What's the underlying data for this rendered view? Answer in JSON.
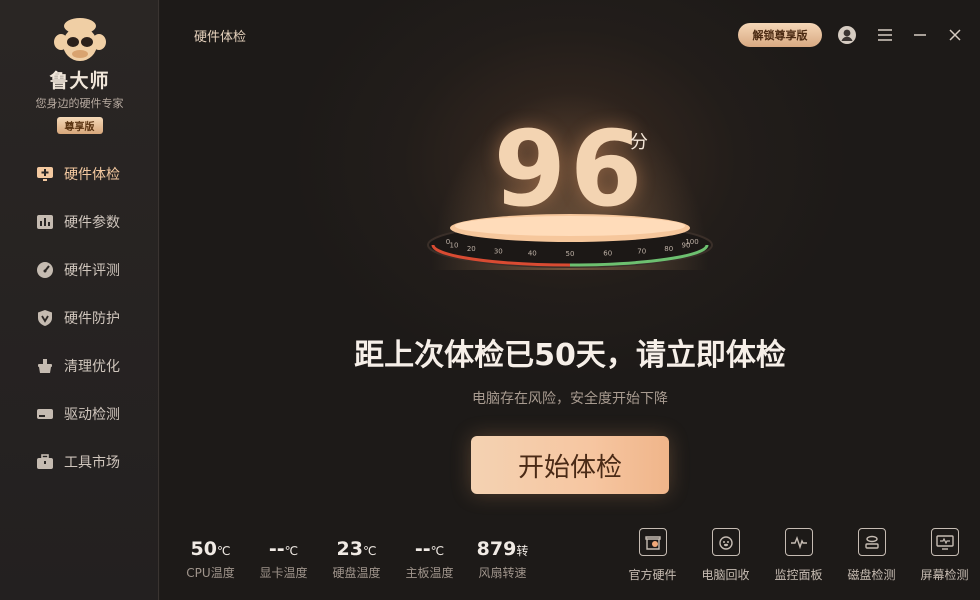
{
  "app": {
    "name": "鲁大师",
    "tagline": "您身边的硬件专家",
    "edition_badge": "尊享版"
  },
  "sidebar": {
    "items": [
      {
        "label": "硬件体检",
        "icon": "plus-monitor-icon",
        "active": true
      },
      {
        "label": "硬件参数",
        "icon": "bar-chart-icon",
        "active": false
      },
      {
        "label": "硬件评测",
        "icon": "speedometer-icon",
        "active": false
      },
      {
        "label": "硬件防护",
        "icon": "shield-icon",
        "active": false
      },
      {
        "label": "清理优化",
        "icon": "broom-icon",
        "active": false
      },
      {
        "label": "驱动检测",
        "icon": "drive-icon",
        "active": false
      },
      {
        "label": "工具市场",
        "icon": "toolbox-icon",
        "active": false
      }
    ]
  },
  "header": {
    "page_title": "硬件体检",
    "unlock_label": "解锁尊享版",
    "icons": [
      "user-avatar-icon",
      "menu-icon",
      "minimize-icon",
      "close-icon"
    ]
  },
  "score": {
    "value": "96",
    "unit": "分",
    "ticks": [
      "0",
      "10",
      "20",
      "30",
      "40",
      "50",
      "60",
      "70",
      "80",
      "90",
      "100"
    ]
  },
  "message": {
    "headline": "距上次体检已50天，请立即体检",
    "subline": "电脑存在风险，安全度开始下降",
    "start_label": "开始体检"
  },
  "stats": [
    {
      "value": "50",
      "unit": "℃",
      "label": "CPU温度"
    },
    {
      "value": "--",
      "unit": "℃",
      "label": "显卡温度"
    },
    {
      "value": "23",
      "unit": "℃",
      "label": "硬盘温度"
    },
    {
      "value": "--",
      "unit": "℃",
      "label": "主板温度"
    },
    {
      "value": "879",
      "unit": "转",
      "label": "风扇转速"
    }
  ],
  "tools": [
    {
      "label": "官方硬件",
      "icon": "shop-icon"
    },
    {
      "label": "电脑回收",
      "icon": "recycle-pig-icon"
    },
    {
      "label": "监控面板",
      "icon": "monitor-panel-icon"
    },
    {
      "label": "磁盘检测",
      "icon": "disk-icon"
    },
    {
      "label": "屏幕检测",
      "icon": "screen-icon"
    }
  ],
  "colors": {
    "accent": "#f4c9a0",
    "background": "#1f1c1a",
    "button": "#f6c6a1"
  }
}
